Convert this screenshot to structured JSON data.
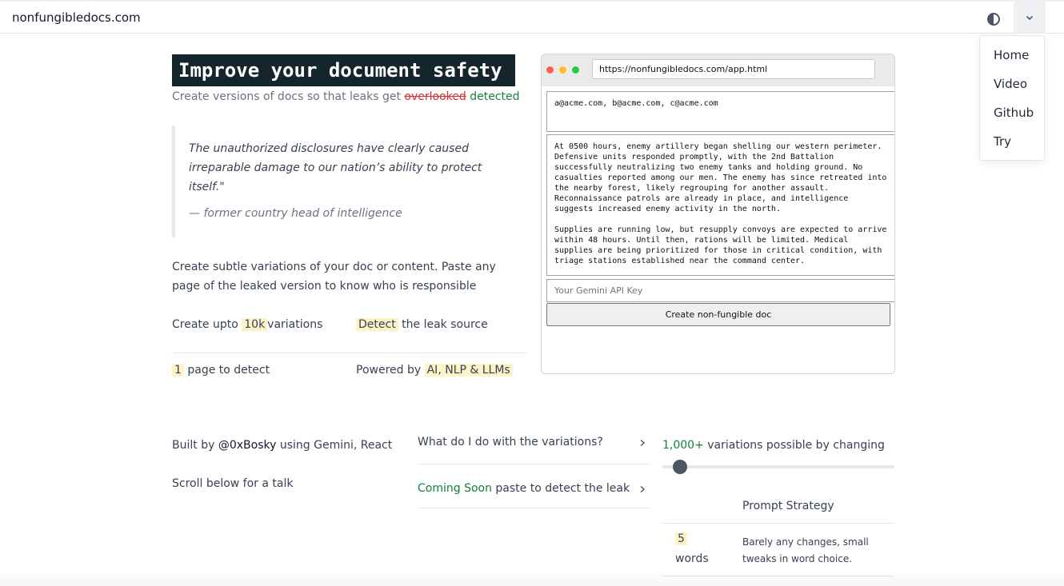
{
  "header": {
    "brand": "nonfungibledocs.com",
    "theme_icon": "half-circle-icon",
    "menu_icon": "chevron-down-icon"
  },
  "menu": {
    "items": [
      "Home",
      "Video",
      "Github",
      "Try"
    ]
  },
  "hero": {
    "title": "Improve your document safety",
    "subtitle_pre": "Create versions of docs so that leaks get ",
    "subtitle_strike": "overlooked",
    "subtitle_post": "detected"
  },
  "quote": {
    "text": "The unauthorized disclosures have clearly caused irreparable damage to our nation’s ability to protect itself.\"",
    "author": "— former country head of intelligence"
  },
  "description": "Create subtle variations of your doc or content. Paste any page of the leaked version to know who is responsible",
  "stats": {
    "create_pre": "Create upto",
    "create_hl": "10k",
    "create_post": "variations",
    "detect_hl": "Detect",
    "detect_post": "the leak source",
    "page_hl": "1",
    "page_post": "page to detect",
    "powered_pre": "Powered by",
    "powered_hl": "AI, NLP & LLMs"
  },
  "browser": {
    "url": "https://nonfungibledocs.com/app.html",
    "emails": "a@acme.com, b@acme.com, c@acme.com",
    "doc_p1": "At 0500 hours, enemy artillery began shelling our western perimeter. Defensive units responded promptly, with the 2nd Battalion successfully neutralizing two enemy tanks and holding ground. No casualties reported among our men. The enemy has since retreated into the nearby forest, likely regrouping for another assault. Reconnaissance patrols are already in place, and intelligence suggests increased enemy activity in the north.",
    "doc_p2": "Supplies are running low, but resupply convoys are expected to arrive within 48 hours. Until then, rations will be limited. Medical supplies are being prioritized for those in critical condition, with triage stations established near the command center.",
    "api_placeholder": "Your Gemini API Key",
    "create_button": "Create non-fungible doc",
    "dot_colors": [
      "#ff5f57",
      "#febc2e",
      "#28c840"
    ]
  },
  "footer": {
    "built_pre": "Built by ",
    "built_handle": "@0xBosky",
    "built_post": " using Gemini, React",
    "scroll": "Scroll below for a talk"
  },
  "accordion": [
    {
      "label": "What do I do with the variations?"
    },
    {
      "label_green": "Coming Soon",
      "label_post": " paste to detect the leak"
    }
  ],
  "variations": {
    "count": "1,000+",
    "text": " variations possible by changing",
    "slider_level": 0.05
  },
  "strategy_table": {
    "header": "Prompt Strategy",
    "rows": [
      {
        "num": "5",
        "unit": "words",
        "desc": "Barely any changes, small tweaks in word choice."
      }
    ]
  },
  "colors": {
    "accent_green": "#15803d",
    "highlight": "#fdf3c7",
    "title_bg": "#14262c",
    "strike_red": "#d32f2f"
  }
}
